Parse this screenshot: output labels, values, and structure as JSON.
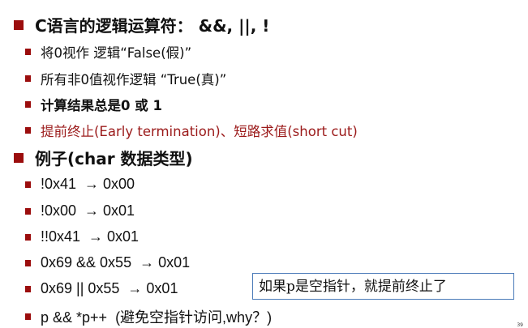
{
  "heading1": "C语言的逻辑运算符： &&, ||, !",
  "points": [
    "将0视作 逻辑“False(假)”",
    "所有非0值视作逻辑 “True(真)”",
    "计算结果总是0 或 1",
    "提前终止(Early termination)、短路求值(short cut)"
  ],
  "heading2": "例子(char 数据类型)",
  "examples": [
    "!0x41  → 0x00",
    "!0x00  → 0x01",
    "!!0x41  → 0x01",
    "0x69 && 0x55  → 0x01",
    "0x69 || 0x55  → 0x01",
    "p && *p++  (避免空指针访问,why？)"
  ],
  "callout": "如果p是空指针，就提前终止了",
  "page_number": "39",
  "colors": {
    "bullet": "#9b0d0d",
    "highlight": "#9b1a1a",
    "callout_border": "#4a7ab8"
  }
}
